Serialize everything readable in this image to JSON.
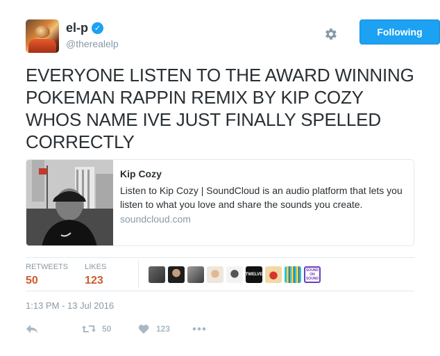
{
  "user": {
    "display_name": "el-p",
    "handle": "@therealelp",
    "verified": true
  },
  "header": {
    "follow_label": "Following",
    "accent_color": "#1da1f2"
  },
  "tweet": {
    "text": "EVERYONE LISTEN TO THE AWARD WINNING POKEMAN RAPPIN REMIX BY KIP COZY WHOS NAME IVE JUST FINALLY SPELLED CORRECTLY"
  },
  "card": {
    "title": "Kip Cozy",
    "description": "Listen to Kip Cozy | SoundCloud is an audio platform that lets you listen to what you love and share the sounds you create.",
    "domain": "soundcloud.com"
  },
  "stats": {
    "retweets_label": "RETWEETS",
    "retweets_value": "50",
    "likes_label": "LIKES",
    "likes_value": "123",
    "value_color": "#cd5c2d"
  },
  "likers": [
    {
      "icon": "avatar-1"
    },
    {
      "icon": "avatar-2"
    },
    {
      "icon": "avatar-3"
    },
    {
      "icon": "avatar-4"
    },
    {
      "icon": "avatar-5"
    },
    {
      "icon": "avatar-twelve",
      "text": "TWELVE"
    },
    {
      "icon": "avatar-7"
    },
    {
      "icon": "avatar-8"
    },
    {
      "icon": "avatar-sound-on-sound",
      "text": "SOUND ON SOUND"
    }
  ],
  "timestamp": "1:13 PM - 13 Jul 2016",
  "actions": {
    "retweet_count": "50",
    "like_count": "123",
    "reply_icon": "reply-icon",
    "retweet_icon": "retweet-icon",
    "like_icon": "heart-icon",
    "more_icon": "more-icon"
  }
}
